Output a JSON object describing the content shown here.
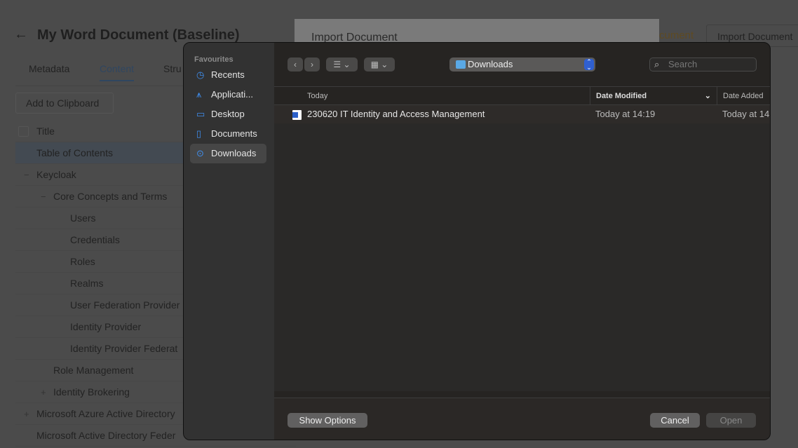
{
  "app": {
    "title": "My Word Document (Baseline)",
    "tabs": [
      "Metadata",
      "Content",
      "Stru"
    ],
    "add_clipboard": "Add to Clipboard",
    "col_title": "Title",
    "tree": [
      {
        "label": "Table of Contents",
        "level": 0,
        "exp": ""
      },
      {
        "label": "Keycloak",
        "level": 0,
        "exp": "−"
      },
      {
        "label": "Core Concepts and Terms",
        "level": 1,
        "exp": "−"
      },
      {
        "label": "Users",
        "level": 2,
        "exp": ""
      },
      {
        "label": "Credentials",
        "level": 2,
        "exp": ""
      },
      {
        "label": "Roles",
        "level": 2,
        "exp": ""
      },
      {
        "label": "Realms",
        "level": 2,
        "exp": ""
      },
      {
        "label": "User Federation Provider",
        "level": 2,
        "exp": ""
      },
      {
        "label": "Identity Provider",
        "level": 2,
        "exp": ""
      },
      {
        "label": "Identity Provider Federat",
        "level": 2,
        "exp": ""
      },
      {
        "label": "Role Management",
        "level": 1,
        "exp": ""
      },
      {
        "label": "Identity Brokering",
        "level": 1,
        "exp": "+"
      },
      {
        "label": "Microsoft Azure Active Directory",
        "level": 0,
        "exp": "+"
      },
      {
        "label": "Microsoft Active Directory Feder",
        "level": 0,
        "exp": ""
      }
    ],
    "import_modal_title": "Import Document",
    "header_link": "cument",
    "header_button": "Import Document"
  },
  "dialog": {
    "favourites": "Favourites",
    "sidebar": [
      {
        "label": "Recents",
        "icon": "clock-icon",
        "glyph": "◷"
      },
      {
        "label": "Applicati...",
        "icon": "applications-icon",
        "glyph": "⩚"
      },
      {
        "label": "Desktop",
        "icon": "desktop-icon",
        "glyph": "▭"
      },
      {
        "label": "Documents",
        "icon": "document-icon",
        "glyph": "▯"
      },
      {
        "label": "Downloads",
        "icon": "download-icon",
        "glyph": "⊙"
      }
    ],
    "location": "Downloads",
    "search_placeholder": "Search",
    "columns": {
      "name": "Today",
      "modified": "Date Modified",
      "added": "Date Added"
    },
    "files": [
      {
        "name": "230620 IT Identity and Access Management",
        "modified": "Today at 14:19",
        "added": "Today at 14"
      }
    ],
    "show_options": "Show Options",
    "cancel": "Cancel",
    "open": "Open"
  }
}
